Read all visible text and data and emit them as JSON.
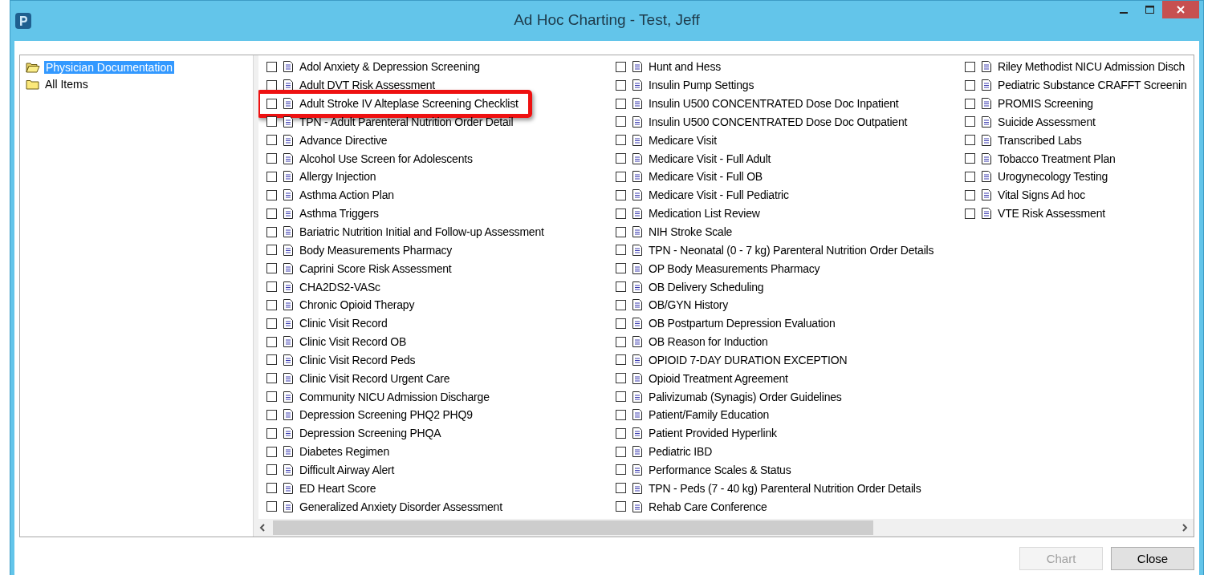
{
  "window": {
    "title": "Ad Hoc Charting - Test, Jeff"
  },
  "tree": [
    {
      "label": "Physician Documentation",
      "selected": true
    },
    {
      "label": "All Items",
      "selected": false
    }
  ],
  "columns": [
    {
      "items": [
        {
          "label": "Adol Anxiety & Depression Screening",
          "checked": false,
          "highlighted": false
        },
        {
          "label": "Adult DVT Risk Assessment",
          "checked": false,
          "highlighted": false
        },
        {
          "label": "Adult Stroke IV Alteplase Screening Checklist",
          "checked": false,
          "highlighted": true
        },
        {
          "label": "TPN - Adult Parenteral Nutrition Order Detail",
          "checked": false,
          "highlighted": false
        },
        {
          "label": "Advance Directive",
          "checked": false,
          "highlighted": false
        },
        {
          "label": "Alcohol Use Screen for Adolescents",
          "checked": false,
          "highlighted": false
        },
        {
          "label": "Allergy Injection",
          "checked": false,
          "highlighted": false
        },
        {
          "label": "Asthma Action Plan",
          "checked": false,
          "highlighted": false
        },
        {
          "label": "Asthma Triggers",
          "checked": false,
          "highlighted": false
        },
        {
          "label": "Bariatric Nutrition Initial and Follow-up Assessment",
          "checked": false,
          "highlighted": false
        },
        {
          "label": "Body Measurements Pharmacy",
          "checked": false,
          "highlighted": false
        },
        {
          "label": "Caprini Score Risk Assessment",
          "checked": false,
          "highlighted": false
        },
        {
          "label": "CHA2DS2-VASc",
          "checked": false,
          "highlighted": false
        },
        {
          "label": "Chronic Opioid Therapy",
          "checked": false,
          "highlighted": false
        },
        {
          "label": "Clinic Visit Record",
          "checked": false,
          "highlighted": false
        },
        {
          "label": "Clinic Visit Record OB",
          "checked": false,
          "highlighted": false
        },
        {
          "label": "Clinic Visit Record Peds",
          "checked": false,
          "highlighted": false
        },
        {
          "label": "Clinic Visit Record Urgent Care",
          "checked": false,
          "highlighted": false
        },
        {
          "label": "Community NICU Admission Discharge",
          "checked": false,
          "highlighted": false
        },
        {
          "label": "Depression Screening PHQ2 PHQ9",
          "checked": false,
          "highlighted": false
        },
        {
          "label": "Depression Screening PHQA",
          "checked": false,
          "highlighted": false
        },
        {
          "label": "Diabetes Regimen",
          "checked": false,
          "highlighted": false
        },
        {
          "label": "Difficult Airway Alert",
          "checked": false,
          "highlighted": false
        },
        {
          "label": "ED Heart Score",
          "checked": false,
          "highlighted": false
        },
        {
          "label": "Generalized Anxiety Disorder Assessment",
          "checked": false,
          "highlighted": false
        }
      ]
    },
    {
      "items": [
        {
          "label": "Hunt and Hess",
          "checked": false,
          "highlighted": false
        },
        {
          "label": "Insulin Pump Settings",
          "checked": false,
          "highlighted": false
        },
        {
          "label": "Insulin U500 CONCENTRATED Dose Doc Inpatient",
          "checked": false,
          "highlighted": false
        },
        {
          "label": "Insulin U500 CONCENTRATED Dose Doc Outpatient",
          "checked": false,
          "highlighted": false
        },
        {
          "label": "Medicare Visit",
          "checked": false,
          "highlighted": false
        },
        {
          "label": "Medicare Visit - Full Adult",
          "checked": false,
          "highlighted": false
        },
        {
          "label": "Medicare Visit - Full OB",
          "checked": false,
          "highlighted": false
        },
        {
          "label": "Medicare Visit - Full Pediatric",
          "checked": false,
          "highlighted": false
        },
        {
          "label": "Medication List Review",
          "checked": false,
          "highlighted": false
        },
        {
          "label": "NIH Stroke Scale",
          "checked": false,
          "highlighted": false
        },
        {
          "label": "TPN - Neonatal (0 - 7 kg) Parenteral Nutrition Order Details",
          "checked": false,
          "highlighted": false
        },
        {
          "label": "OP Body Measurements Pharmacy",
          "checked": false,
          "highlighted": false
        },
        {
          "label": "OB Delivery Scheduling",
          "checked": false,
          "highlighted": false
        },
        {
          "label": "OB/GYN History",
          "checked": false,
          "highlighted": false
        },
        {
          "label": "OB Postpartum Depression Evaluation",
          "checked": false,
          "highlighted": false
        },
        {
          "label": "OB Reason for Induction",
          "checked": false,
          "highlighted": false
        },
        {
          "label": "OPIOID 7-DAY DURATION EXCEPTION",
          "checked": false,
          "highlighted": false
        },
        {
          "label": "Opioid Treatment Agreement",
          "checked": false,
          "highlighted": false
        },
        {
          "label": "Palivizumab (Synagis) Order Guidelines",
          "checked": false,
          "highlighted": false
        },
        {
          "label": "Patient/Family Education",
          "checked": false,
          "highlighted": false
        },
        {
          "label": "Patient Provided Hyperlink",
          "checked": false,
          "highlighted": false
        },
        {
          "label": "Pediatric IBD",
          "checked": false,
          "highlighted": false
        },
        {
          "label": "Performance Scales & Status",
          "checked": false,
          "highlighted": false
        },
        {
          "label": "TPN - Peds (7 - 40 kg) Parenteral Nutrition Order Details",
          "checked": false,
          "highlighted": false
        },
        {
          "label": "Rehab Care Conference",
          "checked": false,
          "highlighted": false
        }
      ]
    },
    {
      "items": [
        {
          "label": "Riley Methodist NICU Admission Disch",
          "checked": false,
          "highlighted": false
        },
        {
          "label": "Pediatric Substance CRAFFT Screenin",
          "checked": false,
          "highlighted": false
        },
        {
          "label": "PROMIS Screening",
          "checked": false,
          "highlighted": false
        },
        {
          "label": "Suicide Assessment",
          "checked": false,
          "highlighted": false
        },
        {
          "label": "Transcribed Labs",
          "checked": false,
          "highlighted": false
        },
        {
          "label": "Tobacco Treatment Plan",
          "checked": false,
          "highlighted": false
        },
        {
          "label": "Urogynecology Testing",
          "checked": false,
          "highlighted": false
        },
        {
          "label": "Vital Signs Ad hoc",
          "checked": false,
          "highlighted": false
        },
        {
          "label": "VTE Risk Assessment",
          "checked": false,
          "highlighted": false
        }
      ]
    }
  ],
  "buttons": [
    {
      "label": "Chart",
      "disabled": true
    },
    {
      "label": "Close",
      "disabled": false
    }
  ]
}
